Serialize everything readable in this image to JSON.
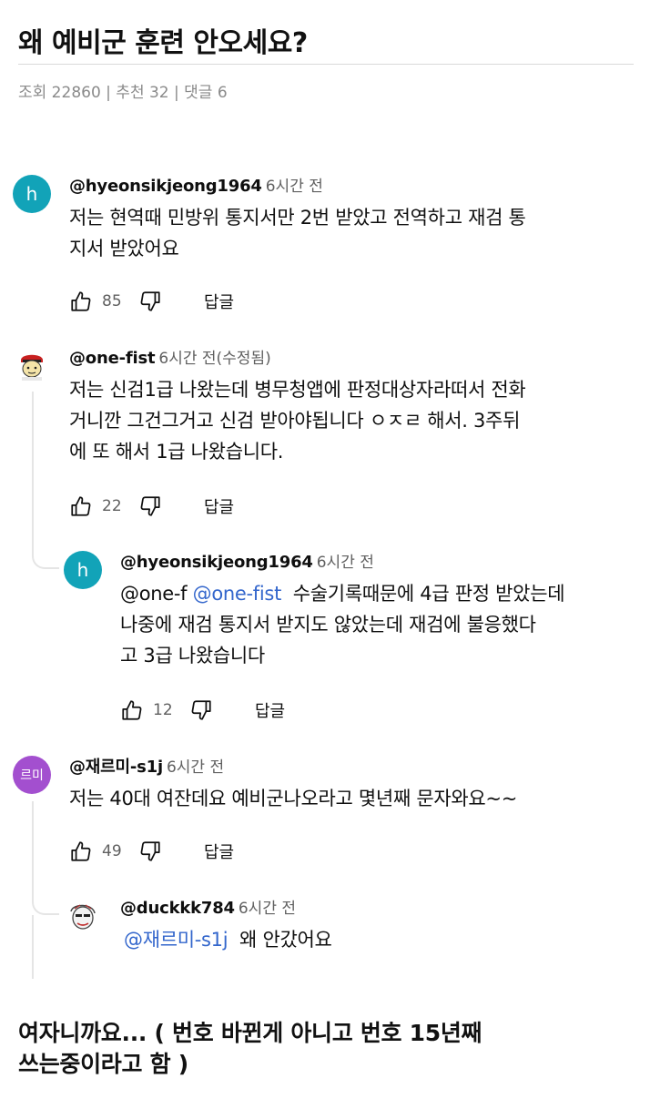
{
  "post": {
    "title": "왜 예비군 훈련 안오세요?",
    "meta": "조회 22860 | 추천 32 | 댓글 6"
  },
  "comments": [
    {
      "username": "@hyeonsikjeong1964",
      "time": "6시간 전",
      "avatar_letter": "h",
      "avatar_color": "#12a3b8",
      "lines": [
        "저는 현역때 민방위 통지서만 2번 받았고 전역하고 재검 통",
        "지서 받았어요"
      ],
      "likes": "85",
      "reply_label": "답글"
    },
    {
      "username": "@one-fist",
      "time": "6시간 전(수정됨)",
      "avatar_icon": "cartoon-face-avatar",
      "lines": [
        "저는 신검1급 나왔는데 병무청앱에 판정대상자라떠서 전화",
        "거니깐 그건그거고 신검 받아야됩니다 ㅇㅈㄹ 해서. 3주뒤",
        "에 또 해서 1급 나왔습니다."
      ],
      "likes": "22",
      "reply_label": "답글"
    },
    {
      "username": "@hyeonsikjeong1964",
      "time": "6시간 전",
      "avatar_letter": "h",
      "avatar_color": "#12a3b8",
      "line1_prefix": "@one-f",
      "line1_mention": "@one-fist",
      "line1_rest": "수술기록때문에 4급 판정 받았는데",
      "lines": [
        "나중에 재검 통지서 받지도 않았는데 재검에 불응했다",
        "고 3급 나왔습니다"
      ],
      "likes": "12",
      "reply_label": "답글"
    },
    {
      "username": "@재르미-s1j",
      "time": "6시간 전",
      "avatar_letter": "르미",
      "avatar_color": "#a34fcf",
      "lines": [
        "저는 40대 여잔데요 예비군나오라고 몇년째 문자와요~~"
      ],
      "likes": "49",
      "reply_label": "답글"
    },
    {
      "username": "@duckkk784",
      "time": "6시간 전",
      "avatar_icon": "sketch-face-avatar",
      "mention": "@재르미-s1j",
      "rest": "왜 안갔어요"
    }
  ],
  "footer": {
    "lines": [
      "여자니까요... ( 번호 바뀐게 아니고 번호 15년째",
      "쓰는중이라고 함 )"
    ]
  },
  "colors": {
    "link": "#3366cc",
    "muted": "#606060",
    "teal": "#12a3b8",
    "purple": "#a34fcf"
  }
}
